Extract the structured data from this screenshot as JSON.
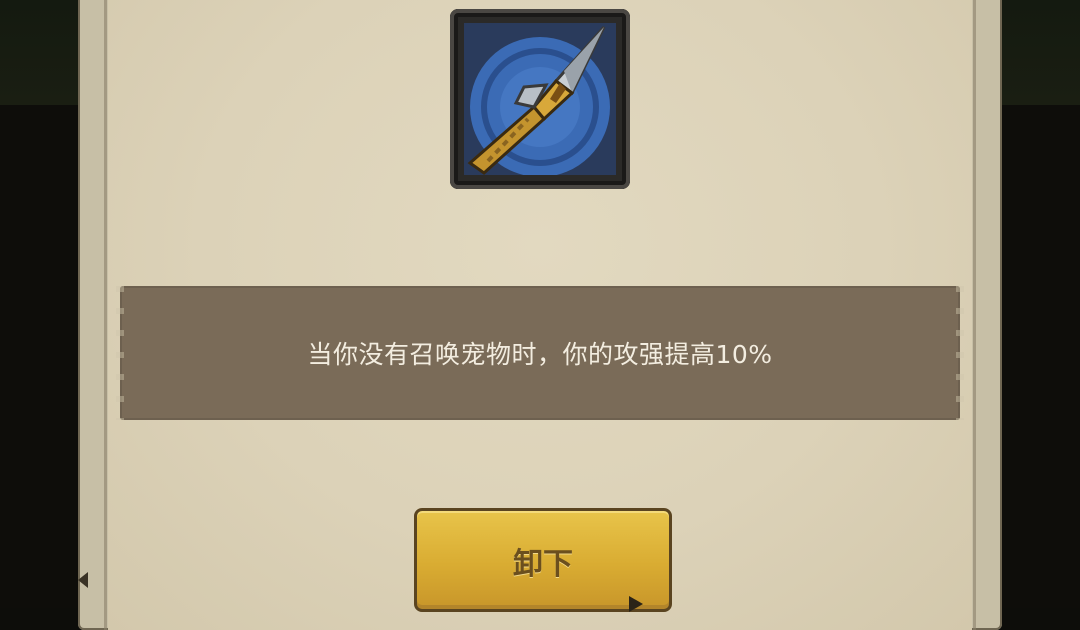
{
  "skill": {
    "icon": "spear-icon",
    "description": "当你没有召唤宠物时，你的攻强提高10%"
  },
  "actions": {
    "unequip_label": "卸下"
  },
  "colors": {
    "parchment": "#dcd2b8",
    "description_bar": "#7a6b58",
    "description_text": "#f3ede0",
    "button_gold": "#d9ac32",
    "button_text": "#6b4f1e",
    "icon_circle": "#3b6bb5"
  }
}
